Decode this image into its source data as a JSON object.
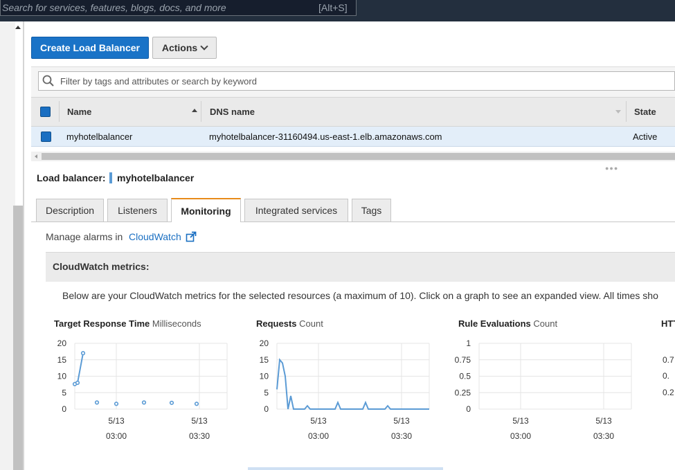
{
  "search": {
    "placeholder": "Search for services, features, blogs, docs, and more",
    "shortcut": "[Alt+S]"
  },
  "toolbar": {
    "create_label": "Create Load Balancer",
    "actions_label": "Actions"
  },
  "filter": {
    "placeholder": "Filter by tags and attributes or search by keyword"
  },
  "table": {
    "columns": [
      "Name",
      "DNS name",
      "State"
    ],
    "rows": [
      {
        "name": "myhotelbalancer",
        "dns": "myhotelbalancer-31160494.us-east-1.elb.amazonaws.com",
        "state": "Active"
      }
    ]
  },
  "details": {
    "label": "Load balancer:",
    "name": "myhotelbalancer"
  },
  "tabs": [
    {
      "label": "Description"
    },
    {
      "label": "Listeners"
    },
    {
      "label": "Monitoring",
      "active": true
    },
    {
      "label": "Integrated services"
    },
    {
      "label": "Tags"
    }
  ],
  "monitoring": {
    "manage_text": "Manage alarms in",
    "cloudwatch_link": "CloudWatch",
    "section_title": "CloudWatch metrics:",
    "description": "Below are your CloudWatch metrics for the selected resources (a maximum of 10). Click on a graph to see an expanded view. All times sho"
  },
  "chart_data": [
    {
      "type": "scatter",
      "title": "Target Response Time",
      "unit": "Milliseconds",
      "ylim": [
        0,
        20
      ],
      "yticks": [
        "20",
        "15",
        "10",
        "5",
        "0"
      ],
      "xticks": [
        [
          "5/13",
          "03:00"
        ],
        [
          "5/13",
          "03:30"
        ]
      ],
      "color": "#5b9bd5",
      "points": [
        {
          "x": "02:45",
          "y": 7.6
        },
        {
          "x": "02:46",
          "y": 8
        },
        {
          "x": "02:48",
          "y": 17
        },
        {
          "x": "02:53",
          "y": 2
        },
        {
          "x": "03:00",
          "y": 1.6
        },
        {
          "x": "03:10",
          "y": 2
        },
        {
          "x": "03:20",
          "y": 1.9
        },
        {
          "x": "03:29",
          "y": 1.6
        }
      ],
      "line_through": [
        "02:45",
        "02:46",
        "02:48"
      ]
    },
    {
      "type": "line",
      "title": "Requests",
      "unit": "Count",
      "ylim": [
        0,
        20
      ],
      "yticks": [
        "20",
        "15",
        "10",
        "5",
        "0"
      ],
      "xticks": [
        [
          "5/13",
          "03:00"
        ],
        [
          "5/13",
          "03:30"
        ]
      ],
      "color": "#5b9bd5",
      "points": [
        {
          "x": "02:45",
          "y": 6
        },
        {
          "x": "02:46",
          "y": 15
        },
        {
          "x": "02:47",
          "y": 14
        },
        {
          "x": "02:48",
          "y": 10
        },
        {
          "x": "02:49",
          "y": 0
        },
        {
          "x": "02:50",
          "y": 4
        },
        {
          "x": "02:51",
          "y": 0
        },
        {
          "x": "02:55",
          "y": 0
        },
        {
          "x": "02:56",
          "y": 1
        },
        {
          "x": "02:57",
          "y": 0
        },
        {
          "x": "03:06",
          "y": 0
        },
        {
          "x": "03:07",
          "y": 2
        },
        {
          "x": "03:08",
          "y": 0
        },
        {
          "x": "03:16",
          "y": 0
        },
        {
          "x": "03:17",
          "y": 2
        },
        {
          "x": "03:18",
          "y": 0
        },
        {
          "x": "03:24",
          "y": 0
        },
        {
          "x": "03:25",
          "y": 1
        },
        {
          "x": "03:26",
          "y": 0
        },
        {
          "x": "03:40",
          "y": 0
        }
      ]
    },
    {
      "type": "line",
      "title": "Rule Evaluations",
      "unit": "Count",
      "ylim": [
        0,
        1
      ],
      "yticks": [
        "1",
        "0.75",
        "0.5",
        "0.25",
        "0"
      ],
      "xticks": [
        [
          "5/13",
          "03:00"
        ],
        [
          "5/13",
          "03:30"
        ]
      ],
      "color": "#5b9bd5",
      "points": []
    },
    {
      "type": "line",
      "title": "HTT",
      "unit": "",
      "yticks": [
        "0.7",
        "0.",
        "0.2"
      ],
      "points": []
    }
  ]
}
